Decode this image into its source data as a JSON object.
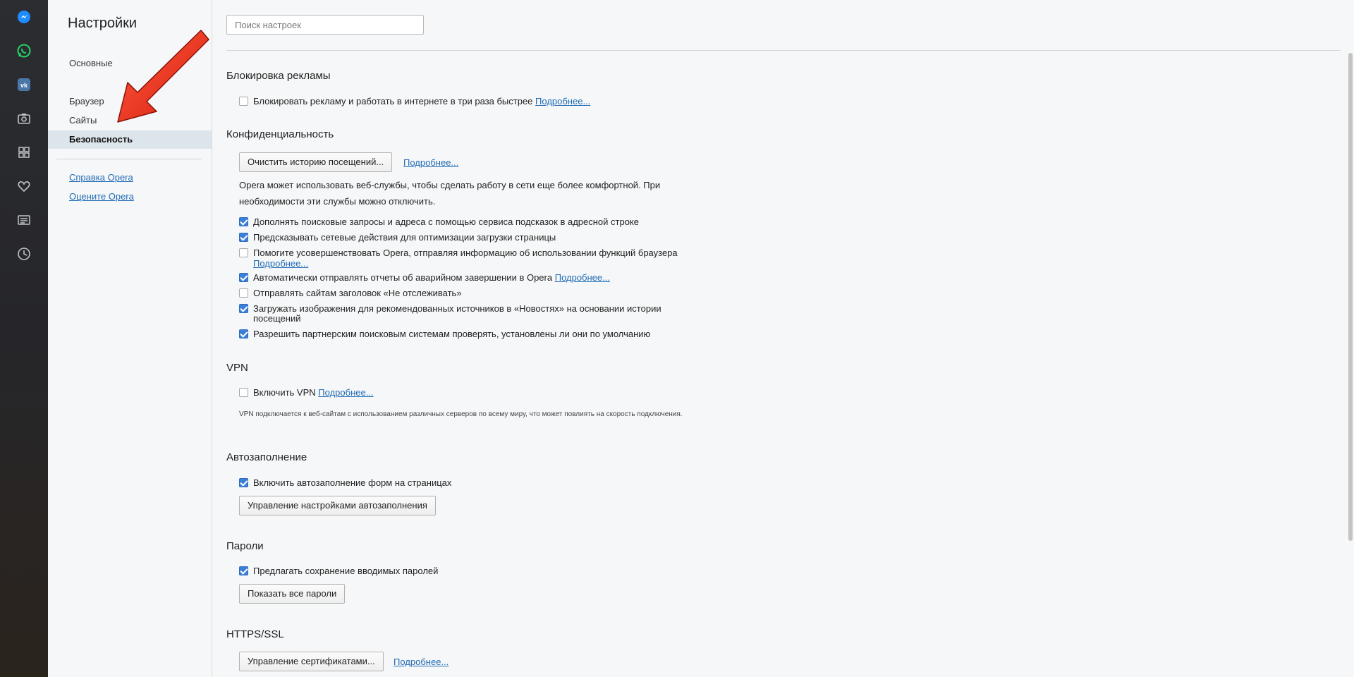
{
  "rail": {
    "icons": [
      "messenger-icon",
      "whatsapp-icon",
      "vk-icon",
      "camera-icon",
      "grid-icon",
      "heart-icon",
      "news-icon",
      "history-icon"
    ],
    "accent": "#1e8cff"
  },
  "sidebar": {
    "title": "Настройки",
    "items": [
      {
        "label": "Основные"
      },
      {
        "label": "Браузер"
      },
      {
        "label": "Сайты"
      },
      {
        "label": "Безопасность"
      }
    ],
    "links": [
      {
        "label": "Справка Opera"
      },
      {
        "label": "Оцените Opera"
      }
    ]
  },
  "search": {
    "placeholder": "Поиск настроек"
  },
  "sections": {
    "adblock": {
      "title": "Блокировка рекламы",
      "option": "Блокировать рекламу и работать в интернете в три раза быстрее",
      "option_checked": false,
      "more": "Подробнее..."
    },
    "privacy": {
      "title": "Конфиденциальность",
      "clear_button": "Очистить историю посещений...",
      "more": "Подробнее...",
      "description": "Opera может использовать веб-службы, чтобы сделать работу в сети еще более комфортной. При необходимости эти службы можно отключить.",
      "options": [
        {
          "label": "Дополнять поисковые запросы и адреса с помощью сервиса подсказок в адресной строке",
          "checked": true
        },
        {
          "label": "Предсказывать сетевые действия для оптимизации загрузки страницы",
          "checked": true
        },
        {
          "label": "Помогите усовершенствовать Opera, отправляя информацию об использовании функций браузера",
          "checked": false,
          "more": "Подробнее..."
        },
        {
          "label": "Автоматически отправлять отчеты об аварийном завершении в Opera",
          "checked": true,
          "more": "Подробнее..."
        },
        {
          "label": "Отправлять сайтам заголовок «Не отслеживать»",
          "checked": false
        },
        {
          "label": "Загружать изображения для рекомендованных источников в «Новостях» на основании истории посещений",
          "checked": true
        },
        {
          "label": "Разрешить партнерским поисковым системам проверять, установлены ли они по умолчанию",
          "checked": true
        }
      ]
    },
    "vpn": {
      "title": "VPN",
      "option": "Включить VPN",
      "option_checked": false,
      "more": "Подробнее...",
      "description": "VPN подключается к веб-сайтам с использованием различных серверов по всему миру, что может повлиять на скорость подключения."
    },
    "autofill": {
      "title": "Автозаполнение",
      "option": "Включить автозаполнение форм на страницах",
      "option_checked": true,
      "button": "Управление настройками автозаполнения"
    },
    "passwords": {
      "title": "Пароли",
      "option": "Предлагать сохранение вводимых паролей",
      "option_checked": true,
      "button": "Показать все пароли"
    },
    "https": {
      "title": "HTTPS/SSL",
      "button": "Управление сертификатами...",
      "more": "Подробнее..."
    }
  },
  "colors": {
    "link": "#1f6bb5",
    "checkbox_checked": "#3b7fd9",
    "annotation_arrow": "#e8321f"
  }
}
